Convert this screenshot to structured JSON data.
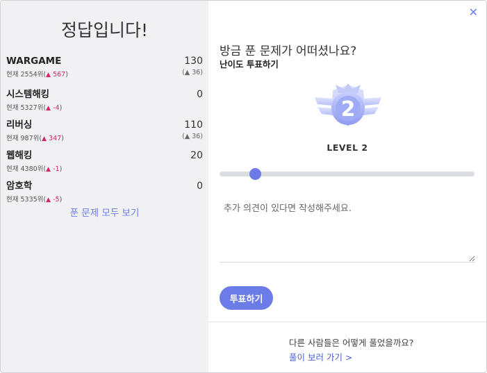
{
  "result": {
    "title": "정답입니다!",
    "categories": [
      {
        "name": "WARGAME",
        "score": "130",
        "rank_prefix": "현재 2554위(",
        "rank_delta": "567",
        "rank_suffix": ")",
        "gain": "(▲ 36)"
      },
      {
        "name": "시스템해킹",
        "score": "0",
        "rank_prefix": "현재 5327위(",
        "rank_delta": "-4",
        "rank_suffix": ")",
        "gain": ""
      },
      {
        "name": "리버싱",
        "score": "110",
        "rank_prefix": "현재 987위(",
        "rank_delta": "347",
        "rank_suffix": ")",
        "gain": "(▲ 36)"
      },
      {
        "name": "웹해킹",
        "score": "20",
        "rank_prefix": "현재 4380위(",
        "rank_delta": "-1",
        "rank_suffix": ")",
        "gain": ""
      },
      {
        "name": "암호학",
        "score": "0",
        "rank_prefix": "현재 5335위(",
        "rank_delta": "-5",
        "rank_suffix": ")",
        "gain": ""
      }
    ],
    "view_all_label": "푼 문제 모두 보기"
  },
  "vote": {
    "question": "방금 푼 문제가 어떠셨나요?",
    "subtitle": "난이도 투표하기",
    "badge_number": "2",
    "level_label": "LEVEL 2",
    "slider_value_fraction": 0.14,
    "comment_placeholder": "추가 의견이 있다면 작성해주세요.",
    "submit_label": "투표하기"
  },
  "others": {
    "question": "다른 사람들은 어떻게 풀었을까요?",
    "link_label": "풀이 보러 가기 >"
  },
  "close_label": "✕",
  "colors": {
    "accent": "#6b7be8",
    "rank_up": "#d6246b",
    "left_bg": "#f1f1f4"
  }
}
